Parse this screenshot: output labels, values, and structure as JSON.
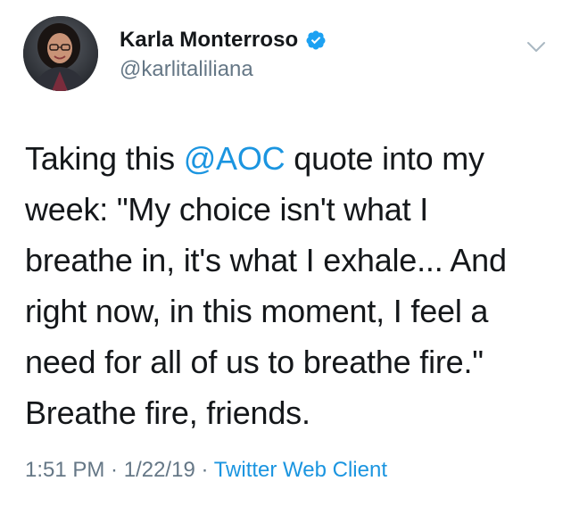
{
  "author": {
    "display_name": "Karla Monterroso",
    "handle": "@karlitaliliana",
    "verified": true,
    "avatar_icon": "profile-photo"
  },
  "menu": {
    "icon": "chevron-down-icon"
  },
  "tweet": {
    "text_before": "Taking this ",
    "mention": "@AOC",
    "text_after": " quote into my week: \"My choice isn't what I breathe in, it's what I exhale... And right now, in this moment, I feel a need for all of us to breathe fire.\" Breathe fire, friends."
  },
  "meta": {
    "time": "1:51 PM",
    "sep1": " · ",
    "date": "1/22/19",
    "sep2": " · ",
    "client": "Twitter Web Client"
  },
  "colors": {
    "link": "#1b95e0",
    "secondary_text": "#657786",
    "primary_text": "#14171a",
    "verified_badge": "#1da1f2"
  }
}
